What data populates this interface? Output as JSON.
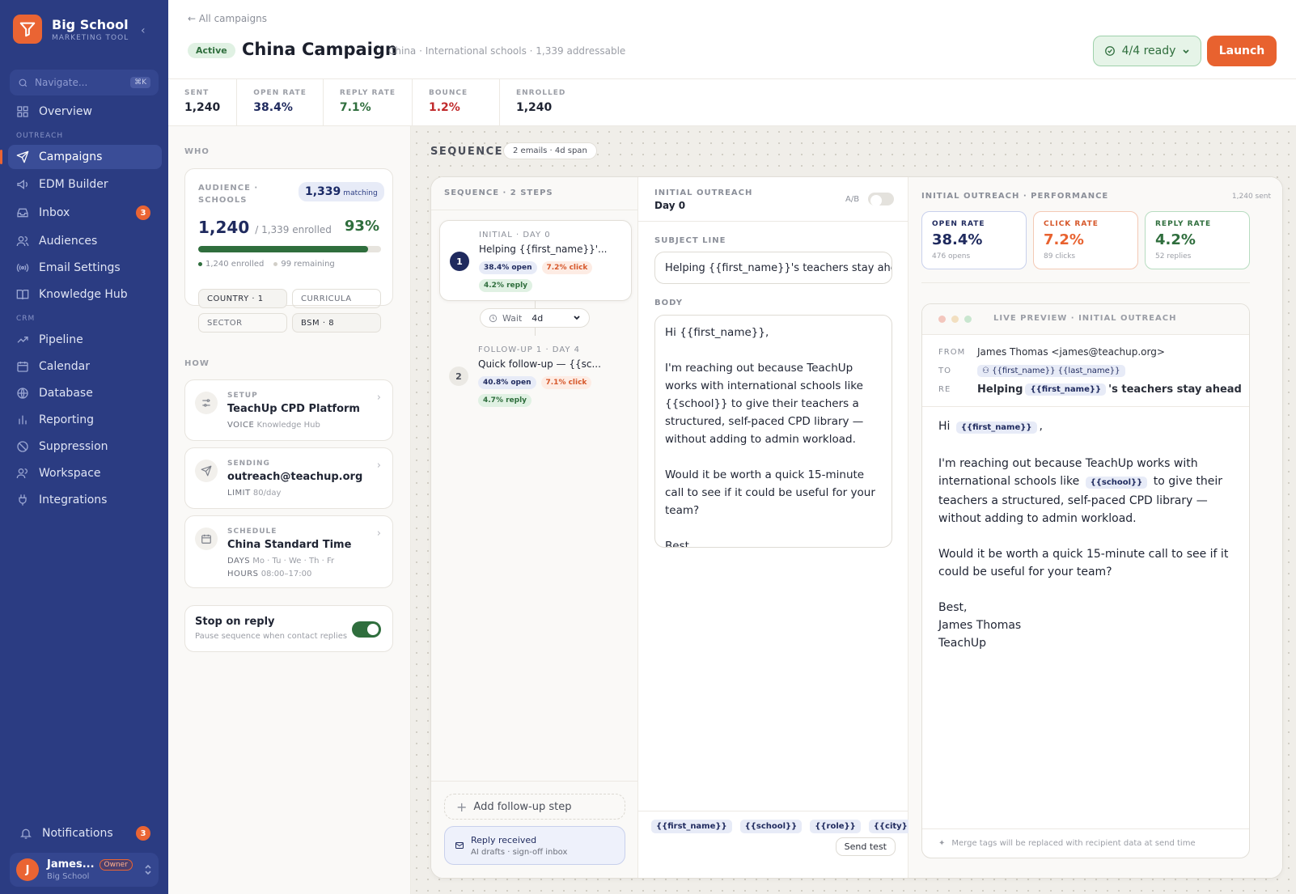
{
  "colors": {
    "sidebar": "#2b3c82",
    "accent": "#e8622f",
    "success": "#2f6e3d",
    "navy": "#1f2a5e",
    "danger": "#c0292b"
  },
  "brand": {
    "name": "Big School",
    "subtitle": "MARKETING TOOL"
  },
  "nav": {
    "search_placeholder": "Navigate...",
    "shortcut": "⌘K",
    "section_outreach": "OUTREACH",
    "section_crm": "CRM",
    "overview": "Overview",
    "campaigns": "Campaigns",
    "edm": "EDM Builder",
    "inbox": "Inbox",
    "inbox_badge": "3",
    "audiences": "Audiences",
    "email_settings": "Email Settings",
    "knowledge": "Knowledge Hub",
    "pipeline": "Pipeline",
    "calendar": "Calendar",
    "database": "Database",
    "reporting": "Reporting",
    "suppression": "Suppression",
    "workspace": "Workspace",
    "integrations": "Integrations",
    "notifications": "Notifications",
    "notifications_badge": "3"
  },
  "user": {
    "initial": "J",
    "name": "James...",
    "role": "Owner",
    "org": "Big School"
  },
  "header": {
    "back": "All campaigns",
    "status": "Active",
    "title": "China Campaign",
    "subtitle": "China · International schools · 1,339 addressable",
    "ready": "4/4 ready",
    "launch": "Launch"
  },
  "stats": [
    {
      "label": "SENT",
      "value": "1,240",
      "color": "#1f2433"
    },
    {
      "label": "OPEN RATE",
      "value": "38.4%",
      "color": "#1f2a5e"
    },
    {
      "label": "REPLY RATE",
      "value": "7.1%",
      "color": "#2f6e3d"
    },
    {
      "label": "BOUNCE",
      "value": "1.2%",
      "color": "#c0292b"
    },
    {
      "label": "ENROLLED",
      "value": "1,240",
      "color": "#1f2433"
    }
  ],
  "who": {
    "label": "WHO",
    "audience_title": "AUDIENCE · SCHOOLS",
    "matching_count": "1,339",
    "matching_label": "matching",
    "enrolled": "1,240",
    "of_total": "/ 1,339 enrolled",
    "percent": "93%",
    "progress": 0.93,
    "enrolled_legend": "1,240 enrolled",
    "remaining_legend": "99 remaining",
    "filters": {
      "country": "COUNTRY · 1",
      "curricula": "CURRICULA",
      "sector": "SECTOR",
      "bsm": "BSM · 8"
    }
  },
  "how": {
    "label": "HOW",
    "setup": {
      "cap": "SETUP",
      "title": "TeachUp CPD Platform",
      "k": "VOICE",
      "v": "Knowledge Hub"
    },
    "sending": {
      "cap": "SENDING",
      "title": "outreach@teachup.org",
      "k": "LIMIT",
      "v": "80/day"
    },
    "schedule": {
      "cap": "SCHEDULE",
      "title": "China Standard Time",
      "days_k": "DAYS",
      "days_v": "Mo · Tu · We · Th · Fr",
      "hours_k": "HOURS",
      "hours_v": "08:00–17:00"
    },
    "stop_title": "Stop on reply",
    "stop_sub": "Pause sequence when contact replies"
  },
  "sequence": {
    "heading": "SEQUENCE",
    "pill": "2 emails · 4d span",
    "steps_head": "SEQUENCE · 2 STEPS",
    "step1": {
      "num": "1",
      "cap": "INITIAL · DAY 0",
      "title": "Helping {{first_name}}'...",
      "open": "38.4% open",
      "click": "7.2% click",
      "reply": "4.2% reply"
    },
    "wait_label": "Wait",
    "wait_value": "4d",
    "step2": {
      "num": "2",
      "cap": "FOLLOW-UP 1 · DAY 4",
      "title": "Quick follow-up — {{sc...",
      "open": "40.8% open",
      "click": "7.1% click",
      "reply": "4.7% reply"
    },
    "add_step": "Add follow-up step",
    "reply_title": "Reply received",
    "reply_sub": "AI drafts · sign-off inbox"
  },
  "editor": {
    "head_cap": "INITIAL OUTREACH",
    "head_day": "Day 0",
    "ab": "A/B",
    "subject_label": "SUBJECT LINE",
    "subject": "Helping {{first_name}}'s teachers stay ahead",
    "body_label": "BODY",
    "body": "Hi {{first_name}},\n\nI'm reaching out because TeachUp works with international schools like {{school}} to give their teachers a structured, self-paced CPD library — without adding to admin workload.\n\nWould it be worth a quick 15-minute call to see if it could be useful for your team?\n\nBest,",
    "tags": [
      "{{first_name}}",
      "{{school}}",
      "{{role}}",
      "{{city}}"
    ],
    "send_test": "Send test"
  },
  "performance": {
    "head": "INITIAL OUTREACH · PERFORMANCE",
    "sent": "1,240 sent",
    "open": {
      "cap": "OPEN RATE",
      "value": "38.4%",
      "sub": "476 opens"
    },
    "click": {
      "cap": "CLICK RATE",
      "value": "7.2%",
      "sub": "89 clicks"
    },
    "reply": {
      "cap": "REPLY RATE",
      "value": "4.2%",
      "sub": "52 replies"
    }
  },
  "preview": {
    "title": "LIVE PREVIEW · INITIAL OUTREACH",
    "from_k": "FROM",
    "from_v": "James Thomas <james@teachup.org>",
    "to_k": "TO",
    "to_v": "{{first_name}} {{last_name}}",
    "re_k": "RE",
    "re_pre": "Helping",
    "re_tag": "{{first_name}}",
    "re_post": "'s teachers stay ahead",
    "hi": "Hi",
    "hi_tag": "{{first_name}}",
    "hi_comma": ",",
    "p2_pre": "I'm reaching out because TeachUp works with international schools like",
    "p2_tag": "{{school}}",
    "p2_post": "to give their teachers a structured, self-paced CPD library — without adding to admin workload.",
    "p3": "Would it be worth a quick 15-minute call to see if it could be useful for your team?",
    "sign1": "Best,",
    "sign2": "James Thomas",
    "sign3": "TeachUp",
    "footer": "Merge tags will be replaced with recipient data at send time"
  }
}
